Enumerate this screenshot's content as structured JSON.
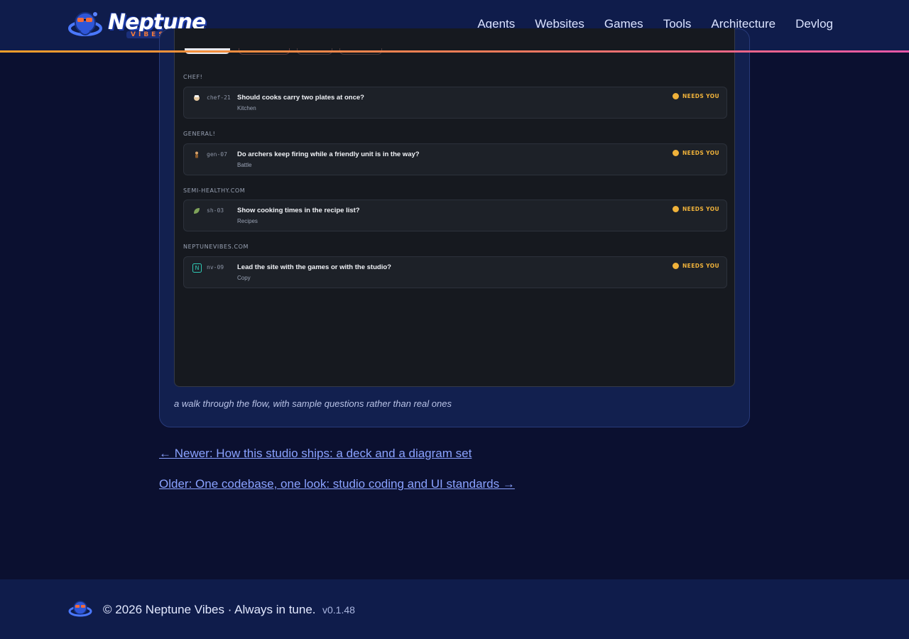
{
  "header": {
    "logo_text": "Neptune",
    "logo_sub": "VIBES",
    "nav": [
      "Agents",
      "Websites",
      "Games",
      "Tools",
      "Architecture",
      "Devlog"
    ]
  },
  "groups": [
    {
      "title": "CHEF!",
      "icon": "chef-icon",
      "id": "chef-21",
      "question": "Should cooks carry two plates at once?",
      "category": "Kitchen",
      "badge": "NEEDS YOU"
    },
    {
      "title": "GENERAL!",
      "icon": "archer-icon",
      "id": "gen-07",
      "question": "Do archers keep firing while a friendly unit is in the way?",
      "category": "Battle",
      "badge": "NEEDS YOU"
    },
    {
      "title": "SEMI-HEALTHY.COM",
      "icon": "leaf-icon",
      "id": "sh-03",
      "question": "Show cooking times in the recipe list?",
      "category": "Recipes",
      "badge": "NEEDS YOU"
    },
    {
      "title": "NEPTUNEVIBES.COM",
      "icon": "n-logo-icon",
      "id": "nv-09",
      "question": "Lead the site with the games or with the studio?",
      "category": "Copy",
      "badge": "NEEDS YOU"
    }
  ],
  "n_icon_letter": "N",
  "caption": "a walk through the flow, with sample questions rather than real ones",
  "post_nav": {
    "newer": "← Newer: How this studio ships: a deck and a diagram set",
    "older": "Older: One codebase, one look: studio coding and UI standards →"
  },
  "footer": {
    "copyright": "© 2026 Neptune Vibes · Always in tune.",
    "version": "v0.1.48"
  },
  "colors": {
    "header_bg": "#0f1c4b",
    "page_bg": "#0b1030",
    "accent_line_start": "#f59e2a",
    "accent_line_end": "#e657a8",
    "badge": "#f0b23a",
    "link": "#8aa2ff"
  }
}
